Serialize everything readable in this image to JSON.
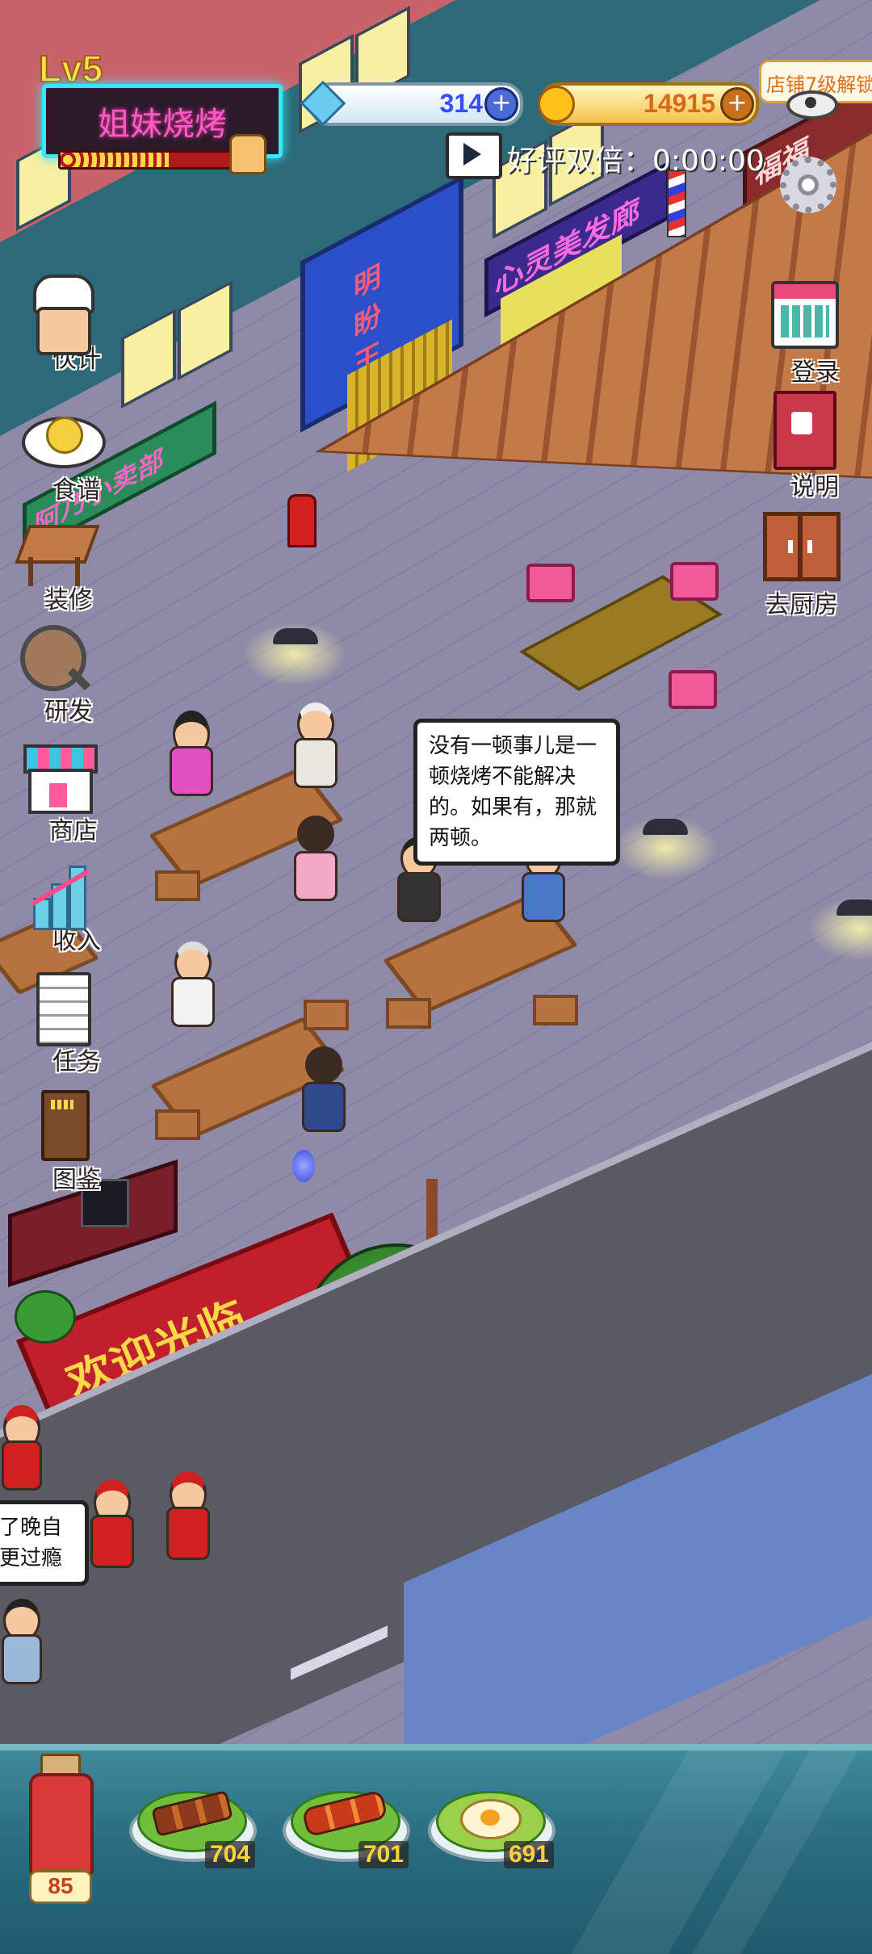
{
  "hud": {
    "level": "Lv5",
    "shop_name": "姐妹烧烤",
    "gems": "314",
    "coins": "14915",
    "unlock_tip": "店铺7级解锁",
    "double_reward_label": "好评双倍：0:00:00"
  },
  "left_menu": [
    {
      "label": "伙计",
      "icon": "chef-icon"
    },
    {
      "label": "食谱",
      "icon": "recipe-icon"
    },
    {
      "label": "装修",
      "icon": "decoration-icon"
    },
    {
      "label": "研发",
      "icon": "research-icon"
    },
    {
      "label": "商店",
      "icon": "shop-icon"
    },
    {
      "label": "收入",
      "icon": "income-chart-icon"
    },
    {
      "label": "任务",
      "icon": "task-icon"
    },
    {
      "label": "图鉴",
      "icon": "collection-book-icon"
    }
  ],
  "right_menu": [
    {
      "label": "登录",
      "icon": "calendar-icon"
    },
    {
      "label": "说明",
      "icon": "guide-book-icon"
    },
    {
      "label": "去厨房",
      "icon": "kitchen-door-icon"
    }
  ],
  "scene": {
    "store_signs": [
      "明盼王",
      "心灵美发廊",
      "阿乃小卖部",
      "福福"
    ],
    "welcome_carpet": "欢迎光临",
    "bubble_main": "没有一顿事儿是一顿烧烤不能解决的。如果有，那就两顿。",
    "bubble_left": "了晚自\n更过瘾"
  },
  "tray": {
    "sauce_amount": "85",
    "dishes": [
      {
        "count": "704",
        "icon": "skewer-dish-icon"
      },
      {
        "count": "701",
        "icon": "sausage-dish-icon"
      },
      {
        "count": "691",
        "icon": "egg-dish-icon"
      }
    ]
  },
  "colors": {
    "neon_pink": "#ff3fb0",
    "neon_cyan": "#39e6ff",
    "gem_blue": "#3a4cff",
    "coin_orange": "#d8681a",
    "deck_wood": "#b96a3c",
    "pavement": "#8e8aa8",
    "tray_teal": "#2a6c80"
  }
}
